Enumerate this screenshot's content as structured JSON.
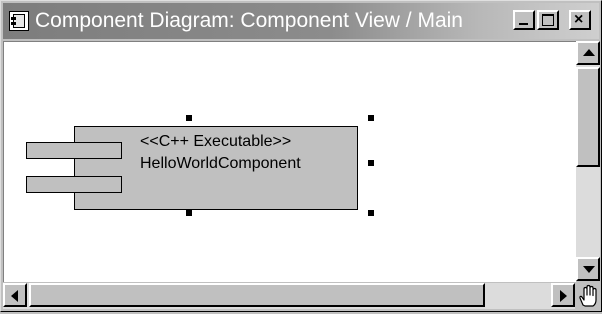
{
  "window": {
    "title": "Component Diagram: Component View / Main",
    "icon": "component-diagram-icon",
    "buttons": {
      "minimize_icon": "minimize-icon",
      "maximize_icon": "maximize-icon",
      "close_icon": "close-icon",
      "close_glyph": "×"
    }
  },
  "diagram": {
    "component": {
      "stereotype": "<<C++ Executable>>",
      "name": "HelloWorldComponent",
      "selected": true
    }
  },
  "scrollbars": {
    "vertical": {
      "up_icon": "arrow-up-icon",
      "down_icon": "arrow-down-icon"
    },
    "horizontal": {
      "left_icon": "arrow-left-icon",
      "right_icon": "arrow-right-icon"
    }
  },
  "cursor": {
    "icon": "hand-cursor-icon"
  },
  "colors": {
    "title_gradient_start": "#7d7d7d",
    "title_gradient_end": "#cfcfcf",
    "canvas_background": "#ffffff",
    "component_fill": "#c0c0c0",
    "chrome": "#c0c0c0"
  }
}
